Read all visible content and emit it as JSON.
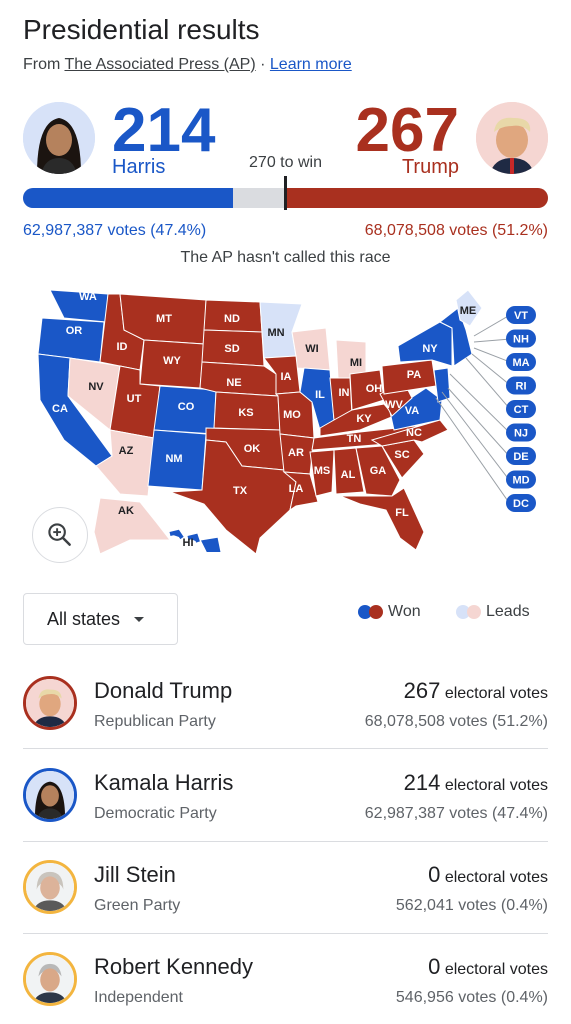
{
  "header": {
    "title": "Presidential results",
    "source_prefix": "From",
    "source_name": "The Associated Press (AP)",
    "separator": "·",
    "learn_more": "Learn more"
  },
  "race": {
    "harris": {
      "ev": "214",
      "name": "Harris",
      "votes": "62,987,387 votes (47.4%)",
      "color": "#1a57c7"
    },
    "trump": {
      "ev": "267",
      "name": "Trump",
      "votes": "68,078,508 votes (51.2%)",
      "color": "#a9301f"
    },
    "to_win": "270 to win",
    "bar": {
      "harris_share": 0.4,
      "trump_share": 0.5,
      "win_threshold": 0.5
    },
    "status": "The AP hasn't called this race"
  },
  "map": {
    "colors": {
      "dem_won": "#1a57c7",
      "rep_won": "#a9301f",
      "dem_leads": "#d7e2f8",
      "rep_leads": "#f5d6d2"
    },
    "state_labels": [
      "WA",
      "OR",
      "CA",
      "NV",
      "ID",
      "MT",
      "WY",
      "UT",
      "AZ",
      "CO",
      "NM",
      "ND",
      "SD",
      "NE",
      "KS",
      "OK",
      "TX",
      "MN",
      "WI",
      "IA",
      "MO",
      "AR",
      "LA",
      "IL",
      "MI",
      "IN",
      "OH",
      "KY",
      "TN",
      "MS",
      "AL",
      "GA",
      "FL",
      "SC",
      "NC",
      "VA",
      "WV",
      "PA",
      "NY",
      "ME",
      "AK",
      "HI"
    ],
    "east_labels": [
      "VT",
      "NH",
      "MA",
      "RI",
      "CT",
      "NJ",
      "DE",
      "MD",
      "DC"
    ]
  },
  "controls": {
    "dropdown_label": "All states",
    "legend_won": "Won",
    "legend_leads": "Leads"
  },
  "candidates": [
    {
      "name": "Donald Trump",
      "party": "Republican Party",
      "ev": "267",
      "ev_label": "electoral votes",
      "votes": "68,078,508 votes (51.2%)",
      "ring": "#a9301f"
    },
    {
      "name": "Kamala Harris",
      "party": "Democratic Party",
      "ev": "214",
      "ev_label": "electoral votes",
      "votes": "62,987,387 votes (47.4%)",
      "ring": "#1a57c7"
    },
    {
      "name": "Jill Stein",
      "party": "Green Party",
      "ev": "0",
      "ev_label": "electoral votes",
      "votes": "562,041 votes (0.4%)",
      "ring": "#f3b53f"
    },
    {
      "name": "Robert Kennedy",
      "party": "Independent",
      "ev": "0",
      "ev_label": "electoral votes",
      "votes": "546,956 votes (0.4%)",
      "ring": "#f3b53f"
    }
  ]
}
